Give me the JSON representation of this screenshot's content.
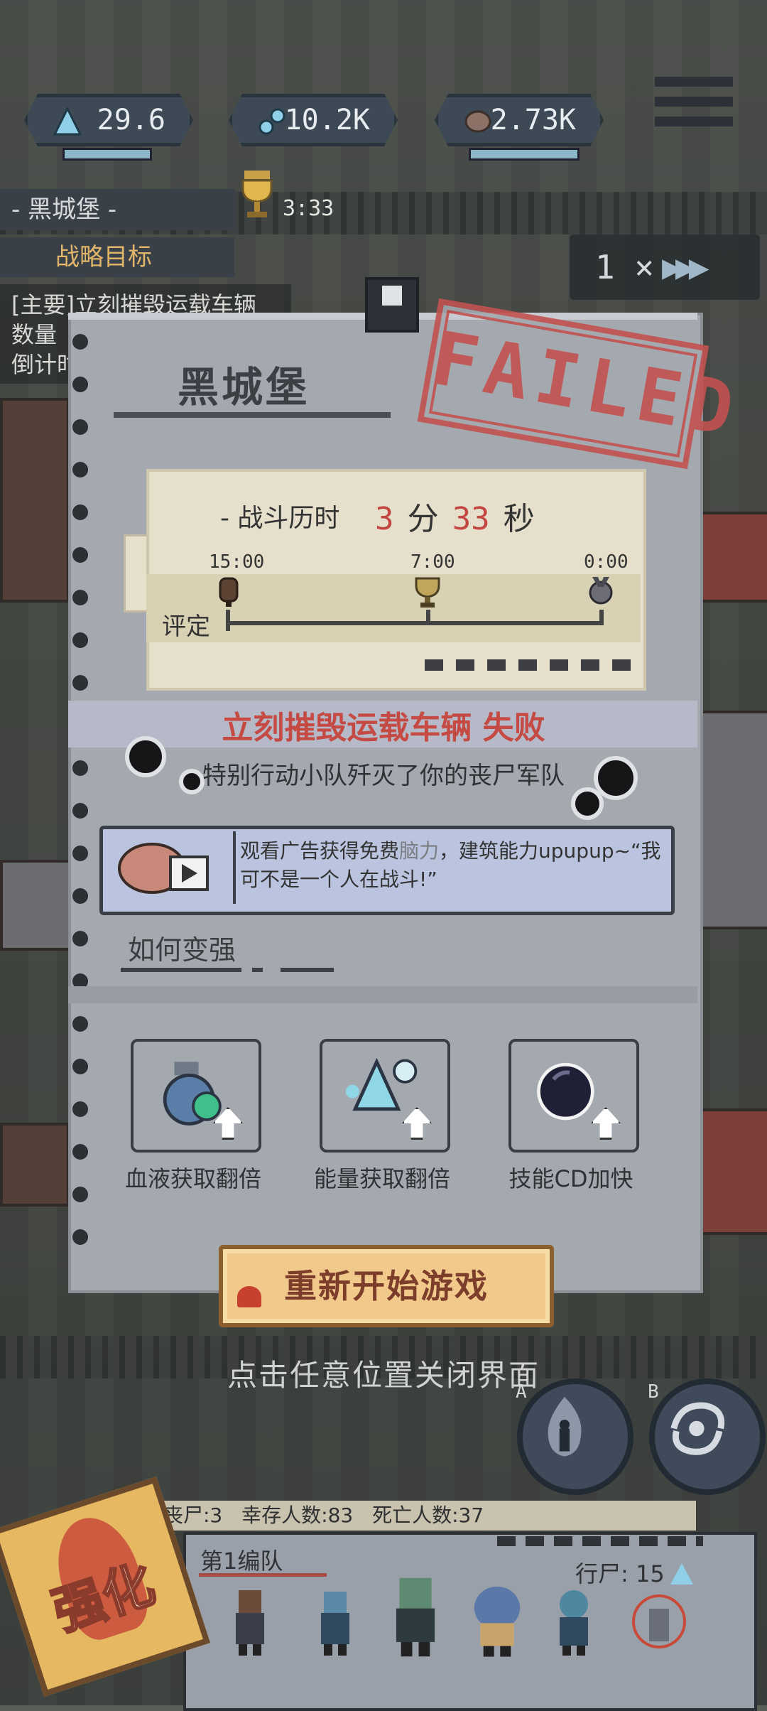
{
  "hud": {
    "resources": [
      {
        "name": "energy",
        "value": "29.6",
        "icon": "triangle-crystal-icon"
      },
      {
        "name": "dna",
        "value": "10.2K",
        "icon": "dna-icon"
      },
      {
        "name": "brain",
        "value": "2.73K",
        "icon": "brain-icon"
      }
    ],
    "level_name": "- 黑城堡 -",
    "timer": "3:33",
    "goal_label": "战略目标",
    "quest_lines": [
      "[主要]立刻摧毁运载车辆",
      "数量",
      "倒计时"
    ],
    "speed_label": "1 ×",
    "speed_arrows": "▶▶▶"
  },
  "result": {
    "level_title": "黑城堡",
    "stamp": "FAILED",
    "battle_time_label": "- 战斗历时",
    "minutes": "3",
    "minutes_unit": "分",
    "seconds": "33",
    "seconds_unit": "秒",
    "rating_label": "评定",
    "ticks": [
      "15:00",
      "7:00",
      "0:00"
    ],
    "objective_failed": "立刻摧毁运载车辆 失败",
    "fail_reason": "特别行动小队歼灭了你的丧尸军队",
    "ad_text_before": "观看广告获得免费",
    "ad_text_highlight": "脑力",
    "ad_text_after": "，建筑能力upupup~“我可不是一个人在战斗!”",
    "howto_label": "如何变强",
    "upgrades": [
      {
        "label": "血液获取翻倍",
        "icon": "blood-flask-icon"
      },
      {
        "label": "能量获取翻倍",
        "icon": "energy-crystal-icon"
      },
      {
        "label": "技能CD加快",
        "icon": "cooldown-orb-icon"
      }
    ],
    "restart_label": "重新开始游戏",
    "close_hint": "点击任意位置关闭界面"
  },
  "skills": [
    {
      "letter": "A",
      "icon": "fire-zombie-icon"
    },
    {
      "letter": "B",
      "icon": "vortex-icon"
    }
  ],
  "bottom": {
    "stats": "丧尸:3 幸存人数:83 死亡人数:37",
    "team_name": "第1编队",
    "walkers_label": "行尸: 15",
    "strengthen_label": "强化"
  },
  "colors": {
    "failed_red": "#c25250",
    "accent_gold": "#e2b66a",
    "restart_bg": "#f1c98b"
  }
}
